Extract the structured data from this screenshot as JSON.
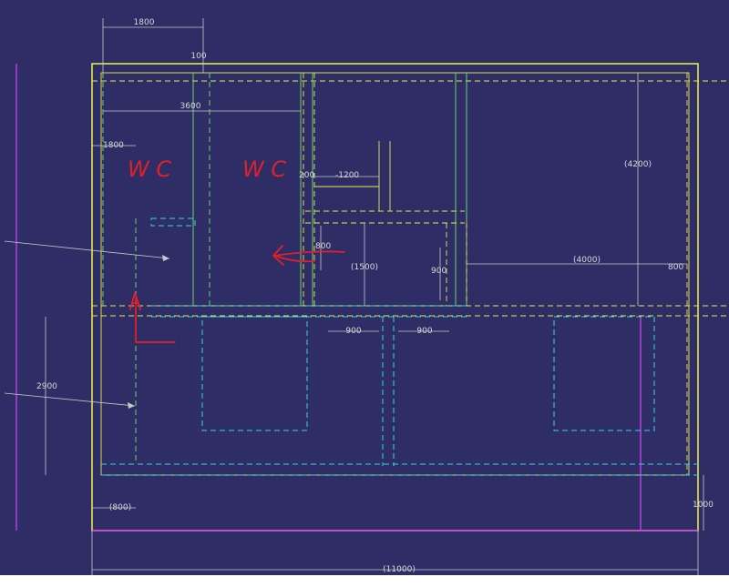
{
  "colors": {
    "background": "#2f2d66",
    "outline": "#e8e84a",
    "cyan": "#36d3e6",
    "green": "#69d36b",
    "magenta": "#c43de3",
    "dimension": "#d8d8d8",
    "redline": "#e0202a"
  },
  "dimensions": {
    "top_1800": "1800",
    "top_100": "100",
    "w_3600": "3600",
    "left_1800": "1800",
    "d_200": "200",
    "d_1200": "-1200",
    "d_4200": "(4200)",
    "d_800_mid": "800",
    "d_1500": "(1500)",
    "d_900_v": "900",
    "d_4000": "(4000)",
    "d_800_right": "800",
    "d_900_a": "900",
    "d_900_b": "900",
    "d_2900": "2900",
    "d_800_bottom": "(800)",
    "d_1000": "1000",
    "d_11000": "(11000)"
  },
  "annotations": {
    "wc_left": "W C",
    "wc_right": "W C"
  }
}
